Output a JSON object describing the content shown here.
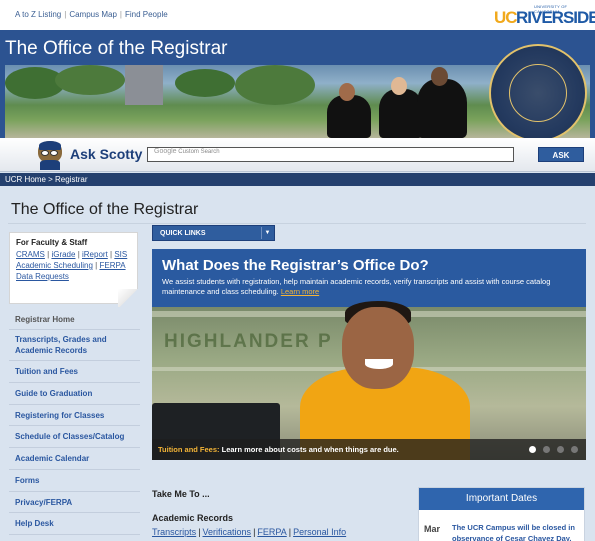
{
  "utility_links": [
    "A to Z Listing",
    "Campus Map",
    "Find People"
  ],
  "logo": {
    "uc": "UC",
    "riverside": "RIVERSIDE",
    "subtitle": "UNIVERSITY OF CALIFORNIA"
  },
  "banner": {
    "title": "The Office of the Registrar"
  },
  "search": {
    "ask_label": "Ask Scotty",
    "placeholder": "Custom Search",
    "google": "Google",
    "button": "ASK"
  },
  "breadcrumb": {
    "home": "UCR Home",
    "sep": " > ",
    "current": "Registrar"
  },
  "page_title": "The Office of the Registrar",
  "faculty": {
    "heading": "For Faculty & Staff",
    "links": [
      "CRAMS",
      "iGrade",
      "iReport",
      "SIS",
      "Academic Scheduling",
      "FERPA",
      "Data Requests"
    ]
  },
  "sidenav": [
    "Registrar Home",
    "Transcripts, Grades and Academic Records",
    "Tuition and Fees",
    "Guide to Graduation",
    "Registering for Classes",
    "Schedule of Classes/Catalog",
    "Academic Calendar",
    "Forms",
    "Privacy/FERPA",
    "Help Desk"
  ],
  "quick_links": {
    "label": "QUICK LINKS",
    "arrow": "▼"
  },
  "hero": {
    "title": "What Does the Registrar’s Office Do?",
    "description": "We assist students with registration, help maintain academic records, verify transcripts and assist with course catalog maintenance and class scheduling.",
    "learn_more": "Learn more",
    "sign_text": "HIGHLANDER P",
    "caption_key": "Tuition and Fees:",
    "caption_rest": "Learn more about costs and when things are due."
  },
  "take_me_to": "Take Me To ...",
  "academic_records": {
    "heading": "Academic Records",
    "links": [
      "Transcripts",
      "Verifications",
      "FERPA",
      "Personal Info"
    ]
  },
  "important_dates": {
    "heading": "Important Dates",
    "month": "Mar",
    "text": "The UCR Campus will be closed in observance of Cesar Chavez Day."
  },
  "colors": {
    "brand_blue": "#2c5391",
    "accent_gold": "#f1a91c",
    "link_blue": "#2a57a0"
  }
}
